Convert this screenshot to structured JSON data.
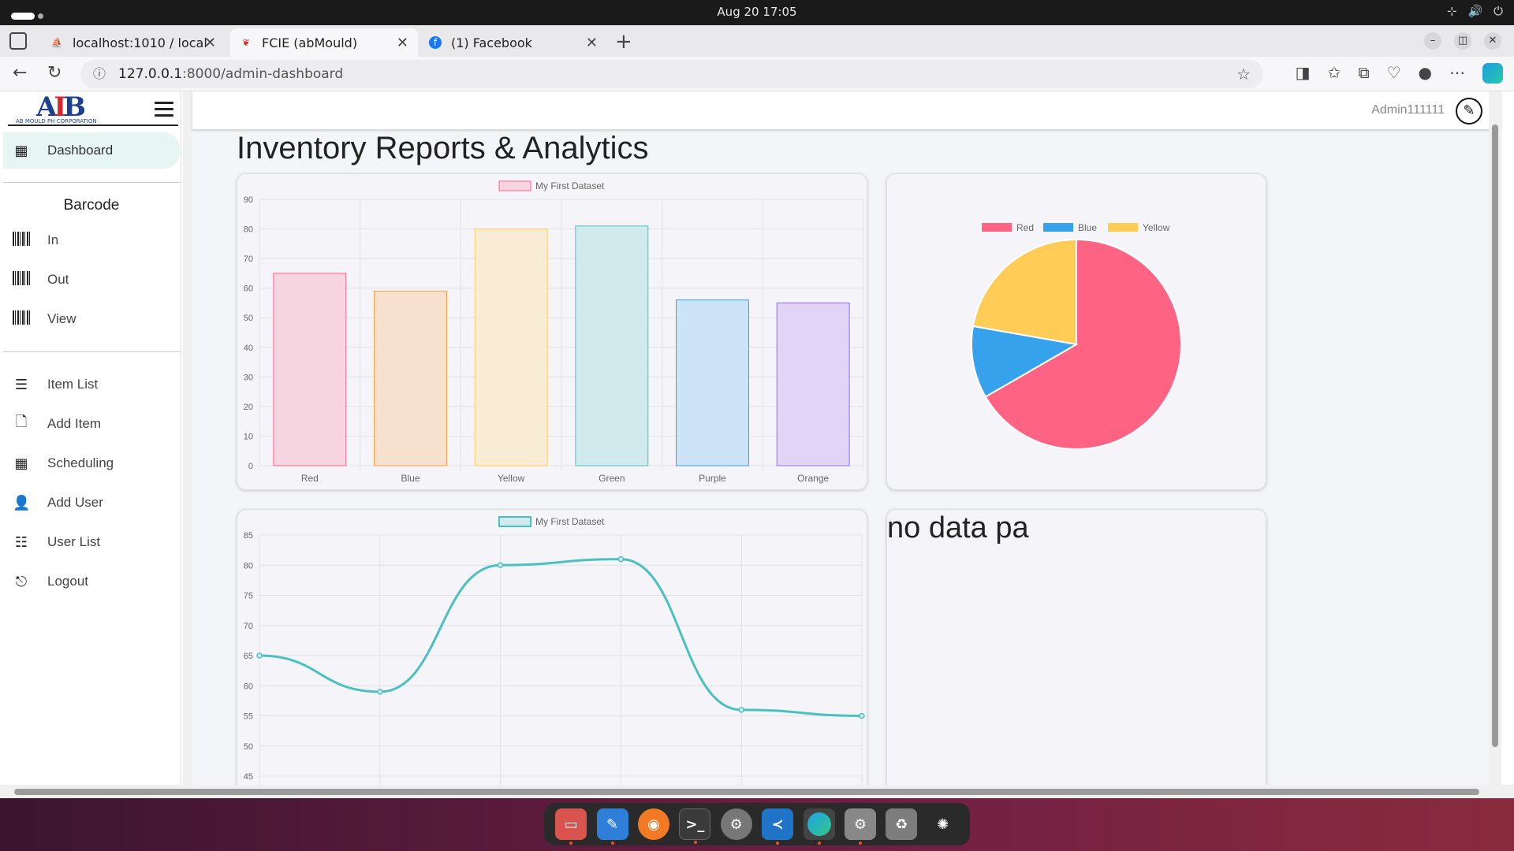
{
  "system": {
    "clock": "Aug 20  17:05"
  },
  "browser": {
    "tabs": [
      {
        "title": "localhost:1010 / localhost"
      },
      {
        "title": "FCIE (abMould)"
      },
      {
        "title": "(1) Facebook"
      }
    ],
    "url_host": "127.0.0.1",
    "url_rest": ":8000/admin-dashboard"
  },
  "sidebar": {
    "logo_text": "AB",
    "logo_sub": "AB MOULD PH CORPORATION",
    "dashboard": "Dashboard",
    "barcode_title": "Barcode",
    "barcode_items": [
      "In",
      "Out",
      "View"
    ],
    "items": [
      "Item List",
      "Add Item",
      "Scheduling",
      "Add User",
      "User List",
      "Logout"
    ]
  },
  "header": {
    "username": "Admin111111"
  },
  "page": {
    "title": "Inventory Reports & Analytics",
    "nodata": "no data pa"
  },
  "chart_data": [
    {
      "type": "bar",
      "categories": [
        "Red",
        "Blue",
        "Yellow",
        "Green",
        "Purple",
        "Orange"
      ],
      "series": [
        {
          "name": "My First Dataset",
          "values": [
            65,
            59,
            80,
            81,
            56,
            55
          ]
        }
      ],
      "ylim": [
        0,
        90
      ],
      "yticks": [
        0,
        10,
        20,
        30,
        40,
        50,
        60,
        70,
        80,
        90
      ],
      "fill": [
        "#f7d5e0",
        "#f7e0cd",
        "#f8ecd5",
        "#d1eaed",
        "#cde3f7",
        "#e0d5f7"
      ],
      "stroke": [
        "#ff6384",
        "#ff9f40",
        "#ffcd56",
        "#4bc0c0",
        "#36a2eb",
        "#9966ff"
      ],
      "legend": "top",
      "grid": true
    },
    {
      "type": "pie",
      "categories": [
        "Red",
        "Blue",
        "Yellow"
      ],
      "values": [
        300,
        50,
        100
      ],
      "colors": [
        "#ff6384",
        "#36a2eb",
        "#ffcd56"
      ],
      "legend": "top"
    },
    {
      "type": "line",
      "x": [
        "",
        "",
        "",
        "",
        "",
        ""
      ],
      "series": [
        {
          "name": "My First Dataset",
          "values": [
            65,
            59,
            80,
            81,
            56,
            55
          ]
        }
      ],
      "ylim": [
        45,
        85
      ],
      "yticks": [
        45,
        50,
        55,
        60,
        65,
        70,
        75,
        80,
        85
      ],
      "color": "#4bc0c0",
      "legend": "top",
      "grid": true
    }
  ]
}
